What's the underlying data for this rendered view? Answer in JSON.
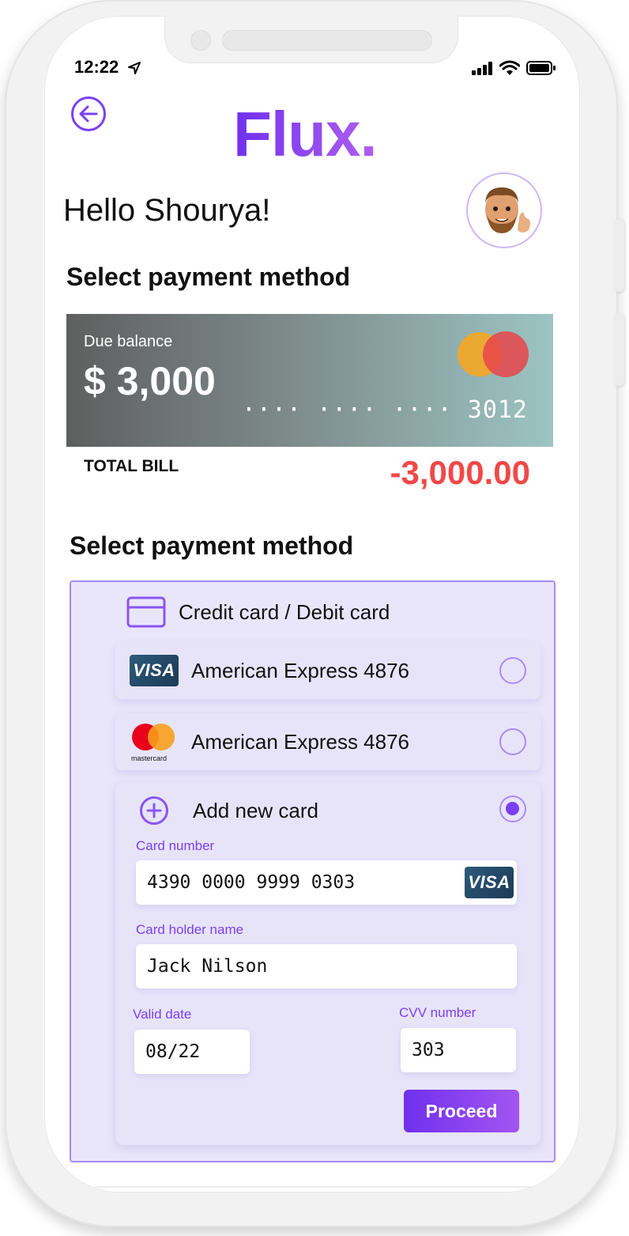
{
  "status_bar": {
    "time": "12:22"
  },
  "header": {
    "logo": "Flux.",
    "greeting": "Hello Shourya!"
  },
  "section_titles": {
    "top": "Select payment method",
    "bottom": "Select payment method"
  },
  "balance_card": {
    "label": "Due balance",
    "amount": "$ 3,000",
    "masked_number": "···· ···· ···· 3012"
  },
  "total": {
    "label": "TOTAL BILL",
    "value": "-3,000.00"
  },
  "payment_methods": {
    "header": "Credit card / Debit card",
    "saved_cards": [
      {
        "brand": "VISA",
        "name": "American Express 4876",
        "selected": false
      },
      {
        "brand": "mastercard",
        "name": "American Express 4876",
        "selected": false
      }
    ],
    "new_card": {
      "title": "Add new card",
      "selected": true,
      "card_number_label": "Card number",
      "card_number": "4390 0000 9999 0303",
      "card_brand": "VISA",
      "holder_label": "Card holder name",
      "holder_name": "Jack Nilson",
      "valid_label": "Valid date",
      "valid_date": "08/22",
      "cvv_label": "CVV number",
      "cvv": "303",
      "proceed_label": "Proceed"
    }
  },
  "colors": {
    "accent": "#7b3ff2",
    "negative": "#f24848",
    "panel": "#e9e6fb"
  }
}
